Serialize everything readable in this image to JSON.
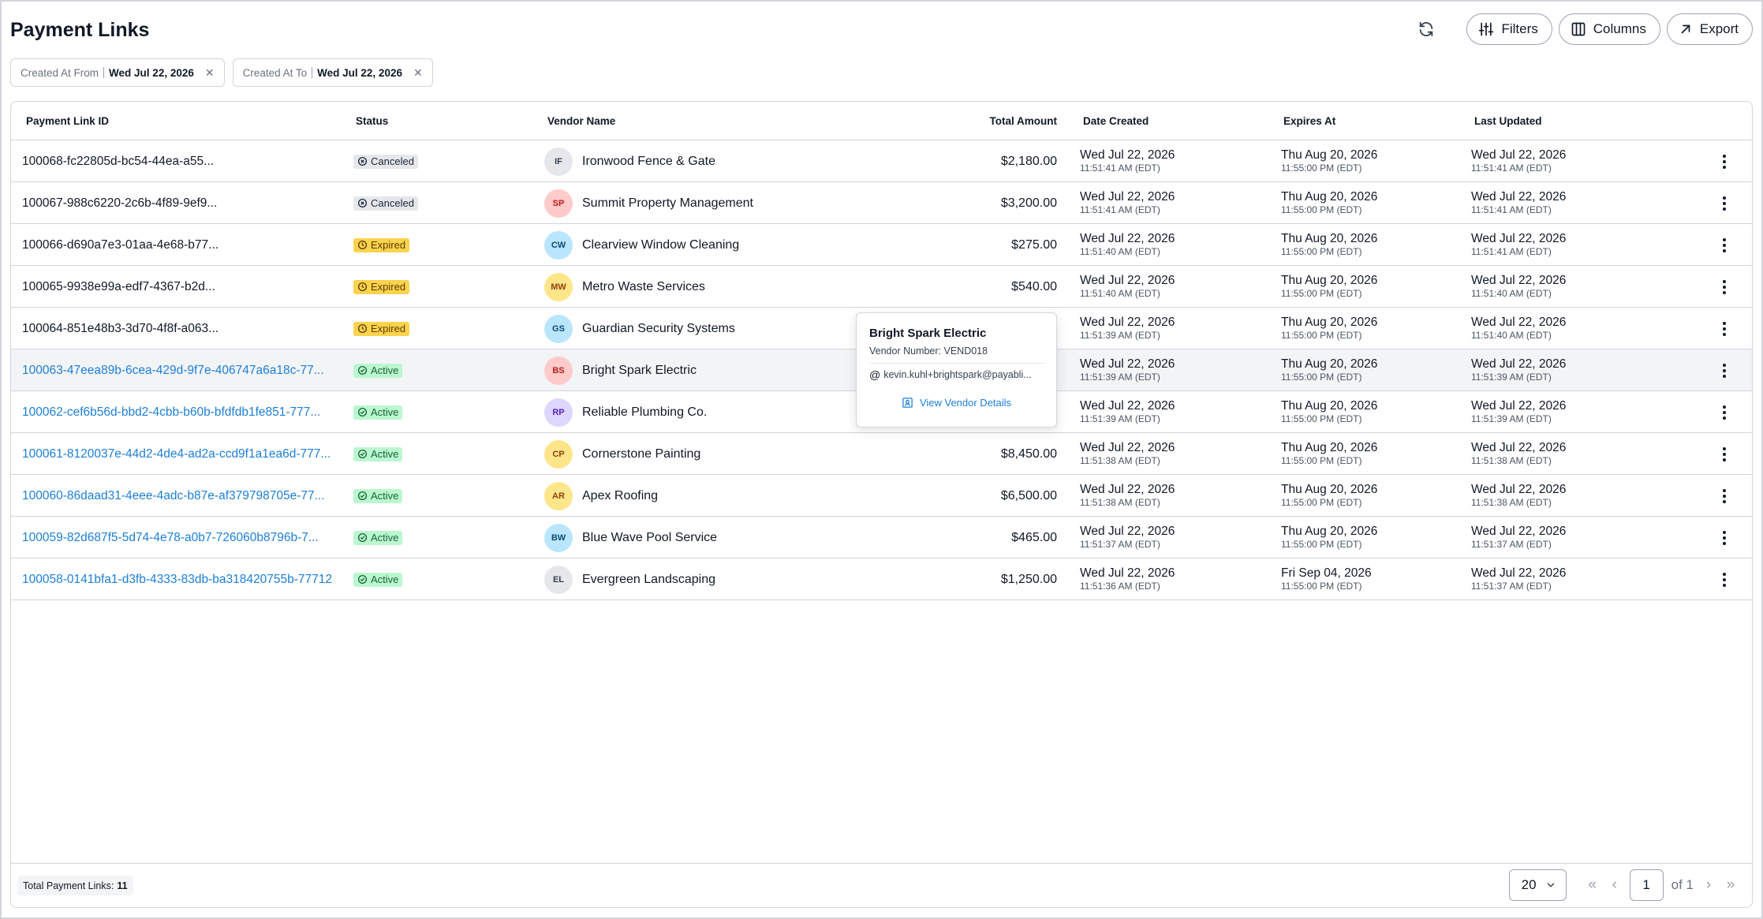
{
  "page": {
    "title": "Payment Links"
  },
  "toolbar": {
    "filters_label": "Filters",
    "columns_label": "Columns",
    "export_label": "Export"
  },
  "chips": [
    {
      "label": "Created At From",
      "value": "Wed Jul 22, 2026"
    },
    {
      "label": "Created At To",
      "value": "Wed Jul 22, 2026"
    }
  ],
  "table": {
    "headers": {
      "id": "Payment Link ID",
      "status": "Status",
      "vendor": "Vendor Name",
      "amount": "Total Amount",
      "created": "Date Created",
      "expires": "Expires At",
      "updated": "Last Updated"
    },
    "rows": [
      {
        "id": "100068-fc22805d-bc54-44ea-a55...",
        "link": false,
        "status": "Canceled",
        "initials": "IF",
        "avatar_bg": "#e5e7eb",
        "avatar_fg": "#374151",
        "vendor": "Ironwood Fence & Gate",
        "amount": "$2,180.00",
        "created_date": "Wed Jul 22, 2026",
        "created_time": "11:51:41 AM (EDT)",
        "expires_date": "Thu Aug 20, 2026",
        "expires_time": "11:55:00 PM (EDT)",
        "updated_date": "Wed Jul 22, 2026",
        "updated_time": "11:51:41 AM (EDT)"
      },
      {
        "id": "100067-988c6220-2c6b-4f89-9ef9...",
        "link": false,
        "status": "Canceled",
        "initials": "SP",
        "avatar_bg": "#fecaca",
        "avatar_fg": "#b91c1c",
        "vendor": "Summit Property Management",
        "amount": "$3,200.00",
        "created_date": "Wed Jul 22, 2026",
        "created_time": "11:51:41 AM (EDT)",
        "expires_date": "Thu Aug 20, 2026",
        "expires_time": "11:55:00 PM (EDT)",
        "updated_date": "Wed Jul 22, 2026",
        "updated_time": "11:51:41 AM (EDT)"
      },
      {
        "id": "100066-d690a7e3-01aa-4e68-b77...",
        "link": false,
        "status": "Expired",
        "initials": "CW",
        "avatar_bg": "#bae6fd",
        "avatar_fg": "#0c4a6e",
        "vendor": "Clearview Window Cleaning",
        "amount": "$275.00",
        "created_date": "Wed Jul 22, 2026",
        "created_time": "11:51:40 AM (EDT)",
        "expires_date": "Thu Aug 20, 2026",
        "expires_time": "11:55:00 PM (EDT)",
        "updated_date": "Wed Jul 22, 2026",
        "updated_time": "11:51:41 AM (EDT)"
      },
      {
        "id": "100065-9938e99a-edf7-4367-b2d...",
        "link": false,
        "status": "Expired",
        "initials": "MW",
        "avatar_bg": "#fde68a",
        "avatar_fg": "#92400e",
        "vendor": "Metro Waste Services",
        "amount": "$540.00",
        "created_date": "Wed Jul 22, 2026",
        "created_time": "11:51:40 AM (EDT)",
        "expires_date": "Thu Aug 20, 2026",
        "expires_time": "11:55:00 PM (EDT)",
        "updated_date": "Wed Jul 22, 2026",
        "updated_time": "11:51:40 AM (EDT)"
      },
      {
        "id": "100064-851e48b3-3d70-4f8f-a063...",
        "link": false,
        "status": "Expired",
        "initials": "GS",
        "avatar_bg": "#bae6fd",
        "avatar_fg": "#0c4a6e",
        "vendor": "Guardian Security Systems",
        "amount": "",
        "created_date": "Wed Jul 22, 2026",
        "created_time": "11:51:39 AM (EDT)",
        "expires_date": "Thu Aug 20, 2026",
        "expires_time": "11:55:00 PM (EDT)",
        "updated_date": "Wed Jul 22, 2026",
        "updated_time": "11:51:40 AM (EDT)"
      },
      {
        "id": "100063-47eea89b-6cea-429d-9f7e-406747a6a18c-77...",
        "link": true,
        "status": "Active",
        "initials": "BS",
        "avatar_bg": "#fecaca",
        "avatar_fg": "#b91c1c",
        "vendor": "Bright Spark Electric",
        "amount": "",
        "created_date": "Wed Jul 22, 2026",
        "created_time": "11:51:39 AM (EDT)",
        "expires_date": "Thu Aug 20, 2026",
        "expires_time": "11:55:00 PM (EDT)",
        "updated_date": "Wed Jul 22, 2026",
        "updated_time": "11:51:39 AM (EDT)"
      },
      {
        "id": "100062-cef6b56d-bbd2-4cbb-b60b-bfdfdb1fe851-777...",
        "link": true,
        "status": "Active",
        "initials": "RP",
        "avatar_bg": "#ddd6fe",
        "avatar_fg": "#5b21b6",
        "vendor": "Reliable Plumbing Co.",
        "amount": "",
        "created_date": "Wed Jul 22, 2026",
        "created_time": "11:51:39 AM (EDT)",
        "expires_date": "Thu Aug 20, 2026",
        "expires_time": "11:55:00 PM (EDT)",
        "updated_date": "Wed Jul 22, 2026",
        "updated_time": "11:51:39 AM (EDT)"
      },
      {
        "id": "100061-8120037e-44d2-4de4-ad2a-ccd9f1a1ea6d-777...",
        "link": true,
        "status": "Active",
        "initials": "CP",
        "avatar_bg": "#fde68a",
        "avatar_fg": "#92400e",
        "vendor": "Cornerstone Painting",
        "amount": "$8,450.00",
        "created_date": "Wed Jul 22, 2026",
        "created_time": "11:51:38 AM (EDT)",
        "expires_date": "Thu Aug 20, 2026",
        "expires_time": "11:55:00 PM (EDT)",
        "updated_date": "Wed Jul 22, 2026",
        "updated_time": "11:51:38 AM (EDT)"
      },
      {
        "id": "100060-86daad31-4eee-4adc-b87e-af379798705e-77...",
        "link": true,
        "status": "Active",
        "initials": "AR",
        "avatar_bg": "#fde68a",
        "avatar_fg": "#92400e",
        "vendor": "Apex Roofing",
        "amount": "$6,500.00",
        "created_date": "Wed Jul 22, 2026",
        "created_time": "11:51:38 AM (EDT)",
        "expires_date": "Thu Aug 20, 2026",
        "expires_time": "11:55:00 PM (EDT)",
        "updated_date": "Wed Jul 22, 2026",
        "updated_time": "11:51:38 AM (EDT)"
      },
      {
        "id": "100059-82d687f5-5d74-4e78-a0b7-726060b8796b-7...",
        "link": true,
        "status": "Active",
        "initials": "BW",
        "avatar_bg": "#bae6fd",
        "avatar_fg": "#0c4a6e",
        "vendor": "Blue Wave Pool Service",
        "amount": "$465.00",
        "created_date": "Wed Jul 22, 2026",
        "created_time": "11:51:37 AM (EDT)",
        "expires_date": "Thu Aug 20, 2026",
        "expires_time": "11:55:00 PM (EDT)",
        "updated_date": "Wed Jul 22, 2026",
        "updated_time": "11:51:37 AM (EDT)"
      },
      {
        "id": "100058-0141bfa1-d3fb-4333-83db-ba318420755b-77712",
        "link": true,
        "status": "Active",
        "initials": "EL",
        "avatar_bg": "#e5e7eb",
        "avatar_fg": "#374151",
        "vendor": "Evergreen Landscaping",
        "amount": "$1,250.00",
        "created_date": "Wed Jul 22, 2026",
        "created_time": "11:51:36 AM (EDT)",
        "expires_date": "Fri Sep 04, 2026",
        "expires_time": "11:55:00 PM (EDT)",
        "updated_date": "Wed Jul 22, 2026",
        "updated_time": "11:51:37 AM (EDT)"
      }
    ]
  },
  "popover": {
    "vendor_name": "Bright Spark Electric",
    "vendor_number": "Vendor Number: VEND018",
    "email": "kevin.kuhl+brightspark@payabli...",
    "link_label": "View Vendor Details"
  },
  "footer": {
    "total_label": "Total Payment Links:",
    "total_value": "11",
    "page_size": "20",
    "current_page": "1",
    "of_label": "of 1"
  },
  "colors": {
    "link": "#1d7fd6",
    "active_badge": "#bbf7d0",
    "expired_badge": "#fcd34d",
    "canceled_badge": "#e5e7eb"
  }
}
